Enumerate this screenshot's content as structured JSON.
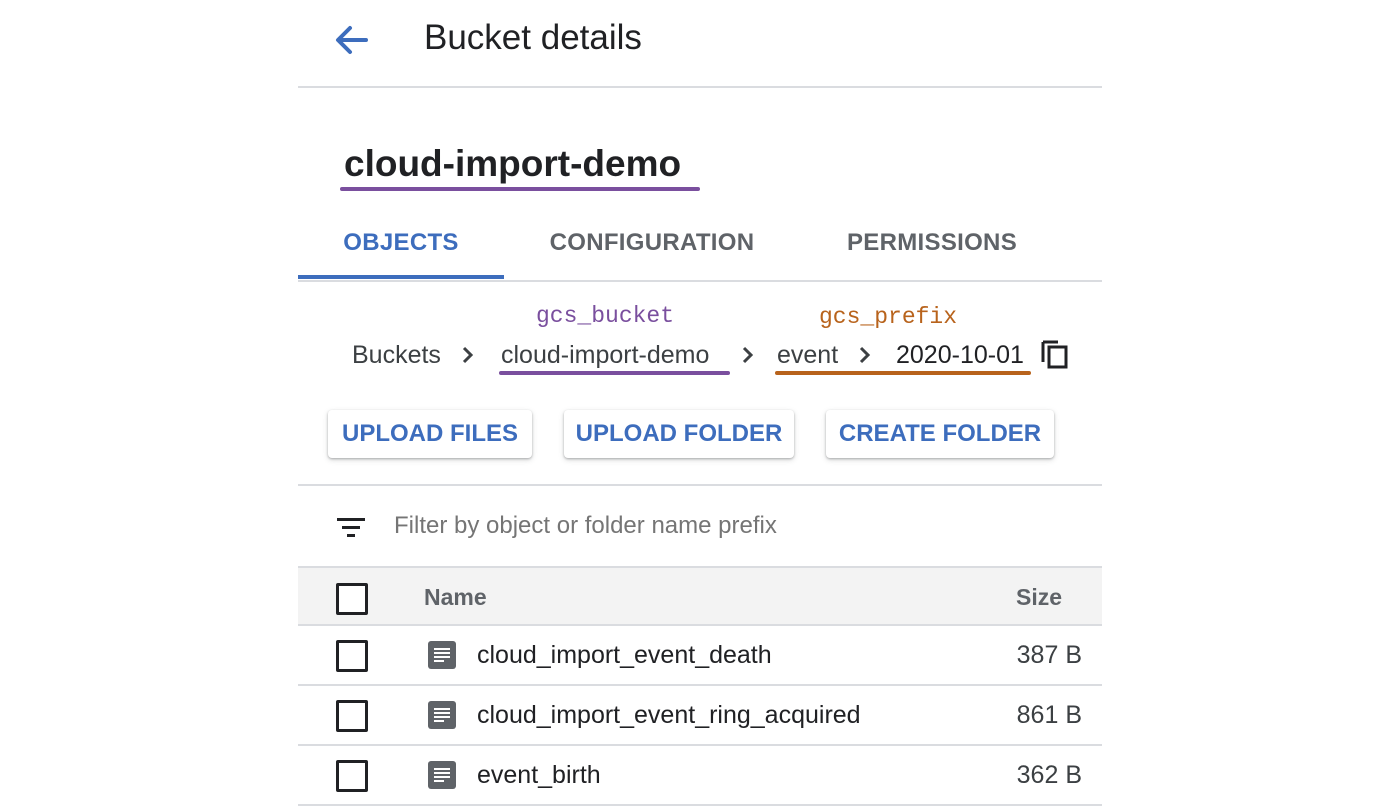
{
  "header": {
    "back_icon": "arrow-back-icon",
    "title": "Bucket details"
  },
  "bucket": {
    "name": "cloud-import-demo"
  },
  "tabs": [
    {
      "label": "OBJECTS",
      "active": true
    },
    {
      "label": "CONFIGURATION",
      "active": false
    },
    {
      "label": "PERMISSIONS",
      "active": false
    }
  ],
  "annotations": {
    "bucket_label": "gcs_bucket",
    "prefix_label": "gcs_prefix",
    "bucket_color": "#7a4f9e",
    "prefix_color": "#b8631c"
  },
  "breadcrumb": {
    "items": [
      "Buckets",
      "cloud-import-demo",
      "event",
      "2020-10-01"
    ],
    "copy_icon": "copy-icon"
  },
  "actions": {
    "upload_files": "UPLOAD FILES",
    "upload_folder": "UPLOAD FOLDER",
    "create_folder": "CREATE FOLDER"
  },
  "filter": {
    "icon": "filter-list-icon",
    "placeholder": "Filter by object or folder name prefix",
    "value": ""
  },
  "table": {
    "columns": {
      "name": "Name",
      "size": "Size"
    },
    "rows": [
      {
        "name": "cloud_import_event_death",
        "size": "387 B",
        "icon": "file-icon"
      },
      {
        "name": "cloud_import_event_ring_acquired",
        "size": "861 B",
        "icon": "file-icon"
      },
      {
        "name": "event_birth",
        "size": "362 B",
        "icon": "file-icon"
      }
    ]
  },
  "colors": {
    "accent": "#3d6dbd",
    "text": "#202124",
    "muted": "#5f6368",
    "divider": "#dadce0"
  }
}
